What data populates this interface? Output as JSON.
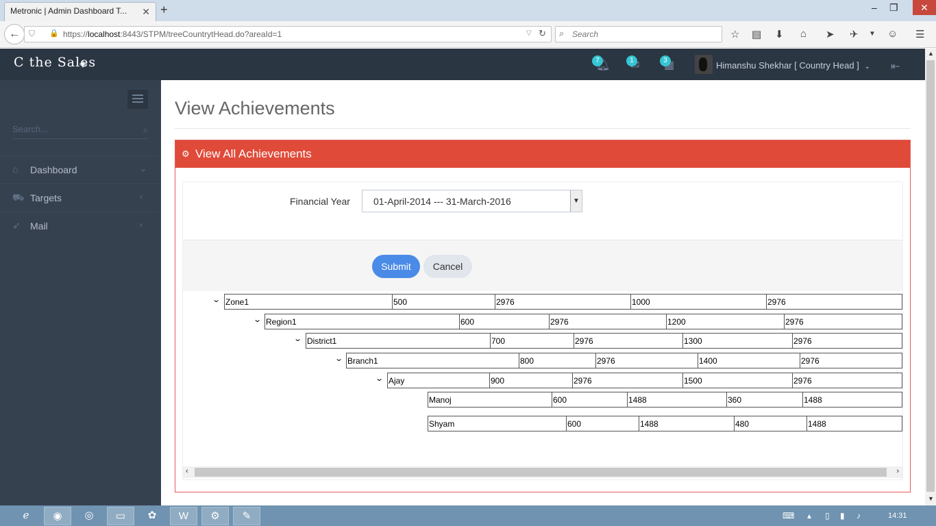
{
  "browser": {
    "tab_title": "Metronic | Admin Dashboard T...",
    "url_prefix": "https://",
    "url_host": "localhost",
    "url_rest": ":8443/STPM/treeCountrytHead.do?areaId=1",
    "search_placeholder": "Search"
  },
  "header": {
    "logo": "C the Sales",
    "notifications_count": "7",
    "inbox_count": "1",
    "tasks_count": "3",
    "username": "Himanshu Shekhar [ Country Head ]"
  },
  "sidebar": {
    "search_placeholder": "Search...",
    "items": [
      {
        "label": "Dashboard",
        "icon": "home-icon",
        "arrow": "chevron-down"
      },
      {
        "label": "Targets",
        "icon": "basket-icon",
        "arrow": "chevron-left"
      },
      {
        "label": "Mail",
        "icon": "rocket-icon",
        "arrow": "chevron-left"
      }
    ]
  },
  "page": {
    "title": "View Achievements",
    "portlet_title": "View All Achievements",
    "financial_year_label": "Financial Year",
    "financial_year_value": "01-April-2014 --- 31-March-2016",
    "submit_label": "Submit",
    "cancel_label": "Cancel"
  },
  "tree": [
    {
      "name": "Zone1",
      "values": [
        "500",
        "2976",
        "1000",
        "2976"
      ],
      "expandable": true
    },
    {
      "name": "Region1",
      "values": [
        "600",
        "2976",
        "1200",
        "2976"
      ],
      "expandable": true
    },
    {
      "name": "District1",
      "values": [
        "700",
        "2976",
        "1300",
        "2976"
      ],
      "expandable": true
    },
    {
      "name": "Branch1",
      "values": [
        "800",
        "2976",
        "1400",
        "2976"
      ],
      "expandable": true
    },
    {
      "name": "Ajay",
      "values": [
        "900",
        "2976",
        "1500",
        "2976"
      ],
      "expandable": true
    },
    {
      "name": "Manoj",
      "values": [
        "600",
        "1488",
        "360",
        "1488"
      ],
      "expandable": false
    },
    {
      "name": "Shyam",
      "values": [
        "600",
        "1488",
        "480",
        "1488"
      ],
      "expandable": false
    }
  ],
  "taskbar": {
    "clock": "14:31"
  },
  "colors": {
    "header_bg": "#2b3643",
    "sidebar_bg": "#364150",
    "portlet_red": "#e04a39",
    "submit_blue": "#4a8be8",
    "badge_teal": "#36c6d3"
  }
}
